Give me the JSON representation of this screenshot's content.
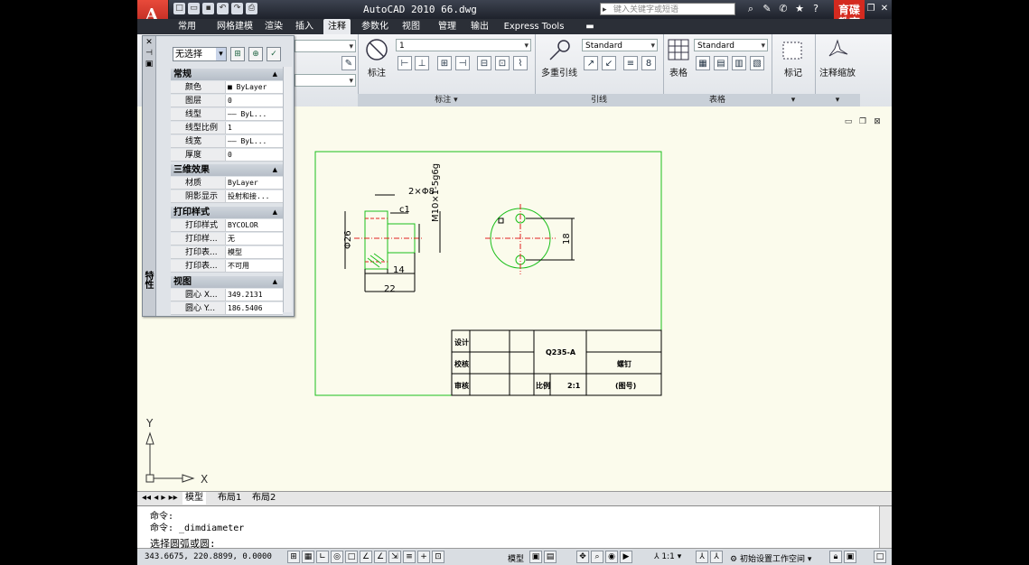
{
  "window": {
    "title": "AutoCAD 2010   66.dwg",
    "search_placeholder": "键入关键字或短语",
    "brand_line1": "育碟",
    "brand_line2": "教育"
  },
  "tabs": [
    "常用",
    "网格建模",
    "渲染",
    "插入",
    "注释",
    "参数化",
    "视图",
    "管理",
    "输出",
    "Express Tools"
  ],
  "active_tab": "注释",
  "ribbon": {
    "text_label": "标注",
    "dim_panel": "标注 ▾",
    "dim_combo": "1",
    "mleader_label": "多重引线",
    "mleader_combo": "Standard",
    "leader_panel": "引线",
    "table_label": "表格",
    "table_combo": "Standard",
    "table_panel": "表格",
    "mark_label": "标记",
    "scale_label": "注释缩放"
  },
  "properties": {
    "selection": "无选择",
    "vertical_label": "特性",
    "sections": [
      {
        "title": "常规",
        "rows": [
          {
            "key": "颜色",
            "value": "■ ByLayer"
          },
          {
            "key": "图层",
            "value": "0"
          },
          {
            "key": "线型",
            "value": "—— ByL..."
          },
          {
            "key": "线型比例",
            "value": "1"
          },
          {
            "key": "线宽",
            "value": "—— ByL..."
          },
          {
            "key": "厚度",
            "value": "0"
          }
        ]
      },
      {
        "title": "三维效果",
        "rows": [
          {
            "key": "材质",
            "value": "ByLayer"
          },
          {
            "key": "阴影显示",
            "value": "投射和接..."
          }
        ]
      },
      {
        "title": "打印样式",
        "rows": [
          {
            "key": "打印样式",
            "value": "BYCOLOR"
          },
          {
            "key": "打印样...",
            "value": "无"
          },
          {
            "key": "打印表...",
            "value": "模型"
          },
          {
            "key": "打印表...",
            "value": "不可用"
          }
        ]
      },
      {
        "title": "视图",
        "rows": [
          {
            "key": "圆心 X...",
            "value": "349.2131"
          },
          {
            "key": "圆心 Y...",
            "value": "186.5406"
          }
        ]
      }
    ]
  },
  "drawing": {
    "dim_2x8": "2×Φ8",
    "dim_c1": "c1",
    "dim_thread": "M10×1-5g6g",
    "dim_26": "Φ26",
    "dim_14": "14",
    "dim_22": "22",
    "dim_18": "18",
    "tb_design": "设计",
    "tb_check": "校核",
    "tb_approve": "审核",
    "tb_material": "Q235-A",
    "tb_name": "螺钉",
    "tb_scale_label": "比例",
    "tb_scale": "2:1",
    "tb_drawno": "(图号)",
    "ucs_x": "X",
    "ucs_y": "Y"
  },
  "layout_tabs": [
    "模型",
    "布局1",
    "布局2"
  ],
  "command": {
    "line1": "命令:",
    "line2": "命令: _dimdiameter",
    "prompt": "选择圆弧或圆:"
  },
  "status": {
    "coords": "343.6675, 220.8899, 0.0000",
    "model": "模型",
    "scale": "1:1",
    "workspace": "初始设置工作空间"
  }
}
